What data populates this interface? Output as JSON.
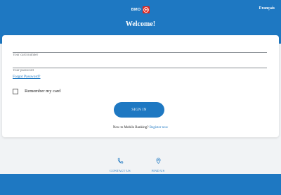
{
  "header": {
    "brand": "BMO",
    "logo_icon": "bmo-roundel-icon",
    "language_link": "Français",
    "welcome": "Welcome!"
  },
  "form": {
    "card_placeholder": "Your card number",
    "password_placeholder": "Your password",
    "forgot_password": "Forgot Password?",
    "remember_label": "Remember my card",
    "signin_label": "SIGN IN",
    "new_prompt": "New to Mobile Banking?",
    "register_link": "Register now"
  },
  "footer": {
    "contact_label": "CONTACT US",
    "contact_icon": "phone-icon",
    "find_label": "FIND US",
    "find_icon": "location-pin-icon"
  },
  "colors": {
    "brand_blue": "#1e78c2",
    "logo_red": "#e2231a",
    "background": "#f1f3f5"
  }
}
